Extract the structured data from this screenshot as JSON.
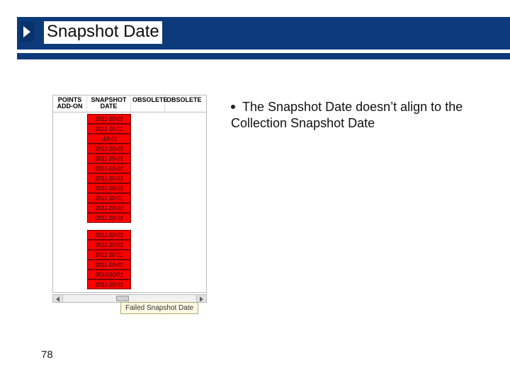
{
  "header": {
    "title": "Snapshot Date"
  },
  "bullet": {
    "text": "The Snapshot Date doesn’t align to the Collection Snapshot Date"
  },
  "table": {
    "columns": [
      "POINTS ADD-ON",
      "SNAPSHOT DATE",
      "OBSOLETE",
      "OBSOLETE"
    ],
    "block1": [
      "2011-10-01",
      "2011 10 01",
      "-10-01",
      "2011-10-01",
      "2011-10-01",
      "2011-10-01",
      "2011-10-01",
      "2011-10-01",
      "2011 10 01",
      "2011-10-01",
      "2011-10-01"
    ],
    "block2": [
      "2011-10-01",
      "2011-10-01",
      "2011 10 01",
      "2011-10-01",
      "2010/10/01",
      "2011-10-01"
    ]
  },
  "tooltip": {
    "text": "Failed Snapshot Date"
  },
  "footer": {
    "page": "78"
  }
}
